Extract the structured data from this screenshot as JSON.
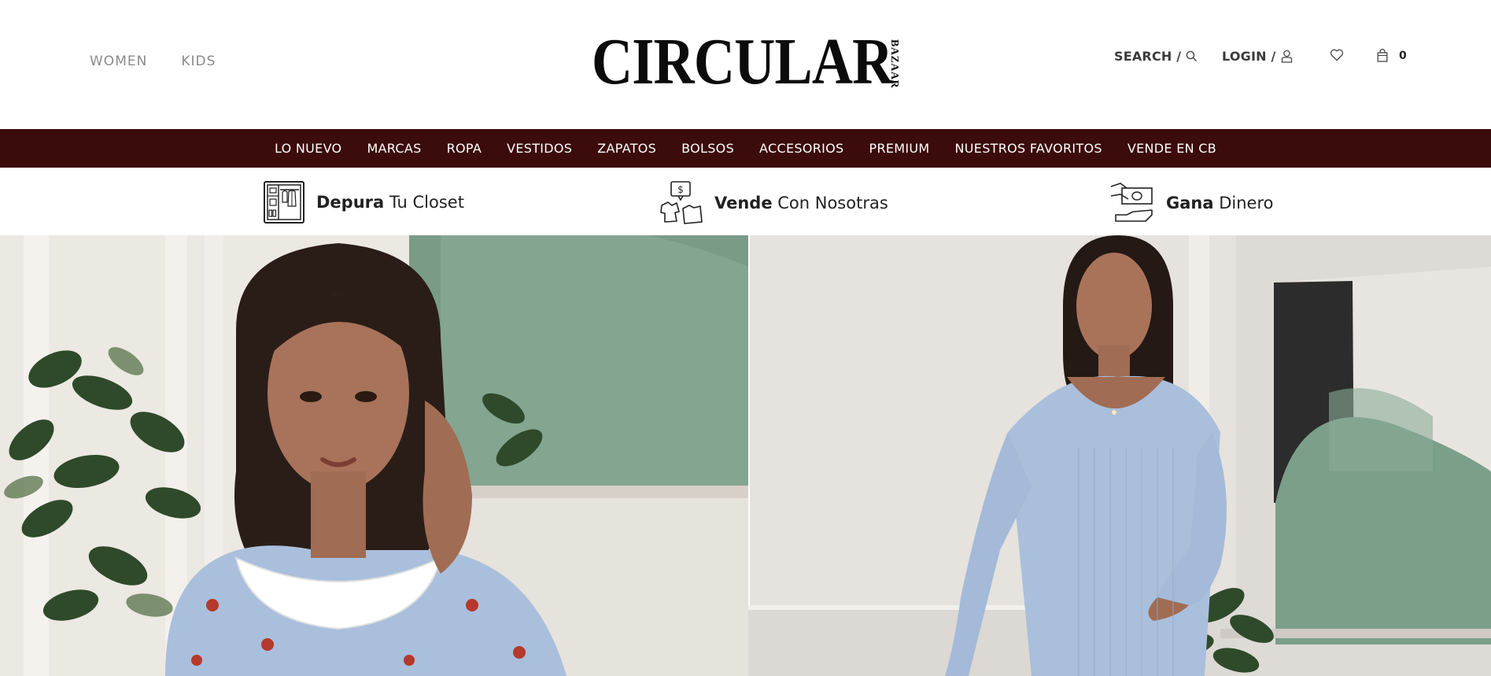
{
  "header": {
    "gender_nav": [
      "WOMEN",
      "KIDS"
    ],
    "logo_main": "CIRCULAR",
    "logo_sub": "BAZAAR",
    "search_label": "SEARCH /",
    "login_label": "LOGIN /",
    "cart_count": "0",
    "icons": [
      "search-icon",
      "user-icon",
      "heart-icon",
      "bag-icon"
    ]
  },
  "categories": [
    "LO NUEVO",
    "MARCAS",
    "ROPA",
    "VESTIDOS",
    "ZAPATOS",
    "BOLSOS",
    "ACCESORIOS",
    "PREMIUM",
    "NUESTROS FAVORITOS",
    "VENDE EN CB"
  ],
  "value_props": [
    {
      "bold": "Depura",
      "rest": " Tu Closet",
      "icon": "closet-icon"
    },
    {
      "bold": "Vende",
      "rest": " Con Nosotras",
      "icon": "sell-clothes-icon"
    },
    {
      "bold": "Gana",
      "rest": " Dinero",
      "icon": "money-hand-icon"
    }
  ],
  "colors": {
    "category_bar": "#3c0b0b",
    "accent_green": "#7a9c86",
    "dress_blue": "#a9bfdc"
  }
}
